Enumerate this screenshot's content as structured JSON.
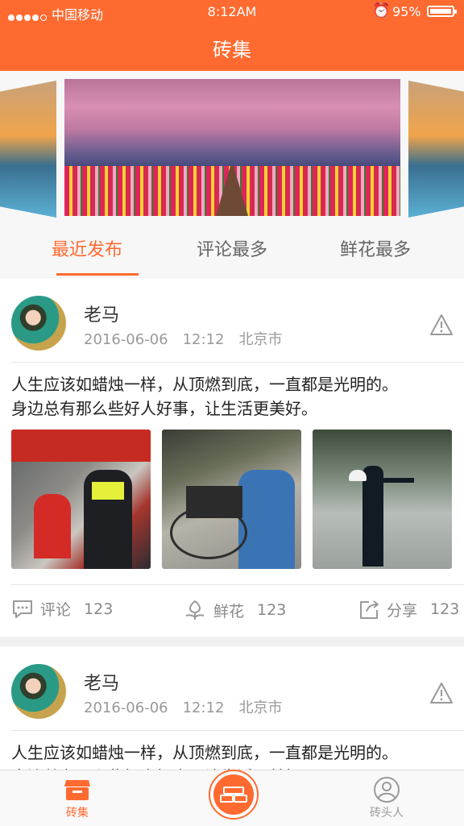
{
  "status_bar": {
    "carrier": "中国移动",
    "time": "8:12AM",
    "battery": "95%"
  },
  "header": {
    "title": "砖集"
  },
  "tabs": [
    {
      "label": "最近发布"
    },
    {
      "label": "评论最多"
    },
    {
      "label": "鲜花最多"
    }
  ],
  "posts": [
    {
      "author": "老马",
      "date": "2016-06-06",
      "time": "12:12",
      "location": "北京市",
      "content_line1": "人生应该如蜡烛一样，从顶燃到底，一直都是光明的。",
      "content_line2": "身边总有那么些好人好事，让生活更美好。",
      "comment_label": "评论",
      "comment_count": "123",
      "flower_label": "鲜花",
      "flower_count": "123",
      "share_label": "分享",
      "share_count": "123"
    },
    {
      "author": "老马",
      "date": "2016-06-06",
      "time": "12:12",
      "location": "北京市",
      "content_line1": "人生应该如蜡烛一样，从顶燃到底，一直都是光明的。",
      "content_line2": "身边总有那么些好人好事，让生活更美好。"
    }
  ],
  "bottom_nav": [
    {
      "label": "砖集"
    },
    {
      "label": "砖头人"
    }
  ],
  "colors": {
    "accent": "#ff6a30",
    "text_secondary": "#999999"
  }
}
